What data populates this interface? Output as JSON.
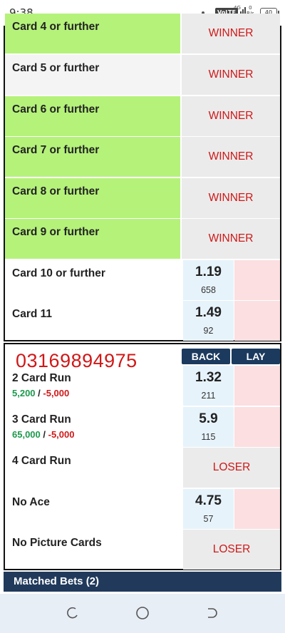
{
  "status_bar": {
    "time": "9:38",
    "network": "4G",
    "volte": "VoLTE",
    "speed_value": "0",
    "speed_unit": "B/s",
    "battery": "40"
  },
  "market_top": {
    "rows": [
      {
        "name": "Card 4 or further",
        "status": "WINNER"
      },
      {
        "name": "Card 5 or further",
        "status": "WINNER"
      },
      {
        "name": "Card 6 or further",
        "status": "WINNER"
      },
      {
        "name": "Card 7 or further",
        "status": "WINNER"
      },
      {
        "name": "Card 8 or further",
        "status": "WINNER"
      },
      {
        "name": "Card 9 or further",
        "status": "WINNER"
      },
      {
        "name": "Card 10 or further",
        "back_price": "1.19",
        "back_size": "658"
      },
      {
        "name": "Card 11",
        "back_price": "1.49",
        "back_size": "92"
      }
    ]
  },
  "market_bottom": {
    "overlay_text": "03169894975",
    "back_label": "BACK",
    "lay_label": "LAY",
    "rows": [
      {
        "name": "2 Card Run",
        "pl_pos": "5,200",
        "pl_sep": " / ",
        "pl_neg": "-5,000",
        "back_price": "1.32",
        "back_size": "211"
      },
      {
        "name": "3 Card Run",
        "pl_pos": "65,000",
        "pl_sep": " / ",
        "pl_neg": "-5,000",
        "back_price": "5.9",
        "back_size": "115"
      },
      {
        "name": "4 Card Run",
        "status": "LOSER"
      },
      {
        "name": "No Ace",
        "back_price": "4.75",
        "back_size": "57"
      },
      {
        "name": "No Picture Cards",
        "status": "LOSER"
      }
    ]
  },
  "matched_bets": {
    "label": "Matched Bets (2)"
  },
  "colors": {
    "winner_green": "#b5f27a",
    "status_red": "#d01818",
    "back_blue": "#e7f3fb",
    "lay_pink": "#fbdfe1",
    "header_navy": "#1b3a5e",
    "profit_green": "#1a9a4c"
  },
  "icons": {
    "nav_recents": "recents-icon",
    "nav_home": "home-icon",
    "nav_back": "back-icon"
  }
}
